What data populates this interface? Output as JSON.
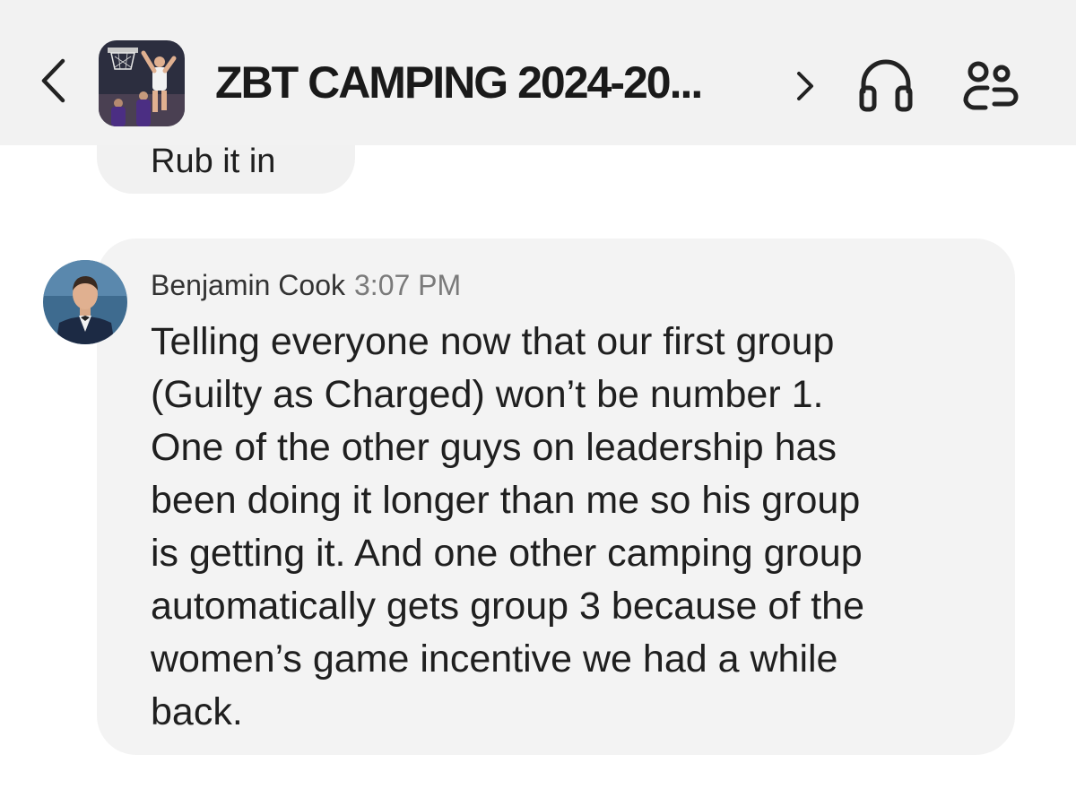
{
  "header": {
    "back_icon": "chevron-left-icon",
    "group_avatar": "basketball-dunk-photo",
    "title": "ZBT CAMPING 2024-20...",
    "chevron_icon": "chevron-right-icon",
    "call_icon": "headphones-icon",
    "members_icon": "members-icon"
  },
  "previous_message": {
    "text": "Rub it in"
  },
  "message": {
    "sender": "Benjamin Cook",
    "time": "3:07 PM",
    "avatar": "profile-photo",
    "lines": [
      "Telling everyone now that our first group",
      "(Guilty as Charged) won’t be number 1.",
      "One of the other guys on leadership has",
      "been doing it longer than me so his group",
      "is getting it. And one other camping group",
      "automatically gets group 3 because of the",
      "women’s game incentive we had a while",
      "back."
    ]
  },
  "colors": {
    "header_bg": "#f2f2f2",
    "bubble_bg": "#f3f3f3",
    "text": "#1f1f1f",
    "timestamp": "#7a7a7a"
  }
}
